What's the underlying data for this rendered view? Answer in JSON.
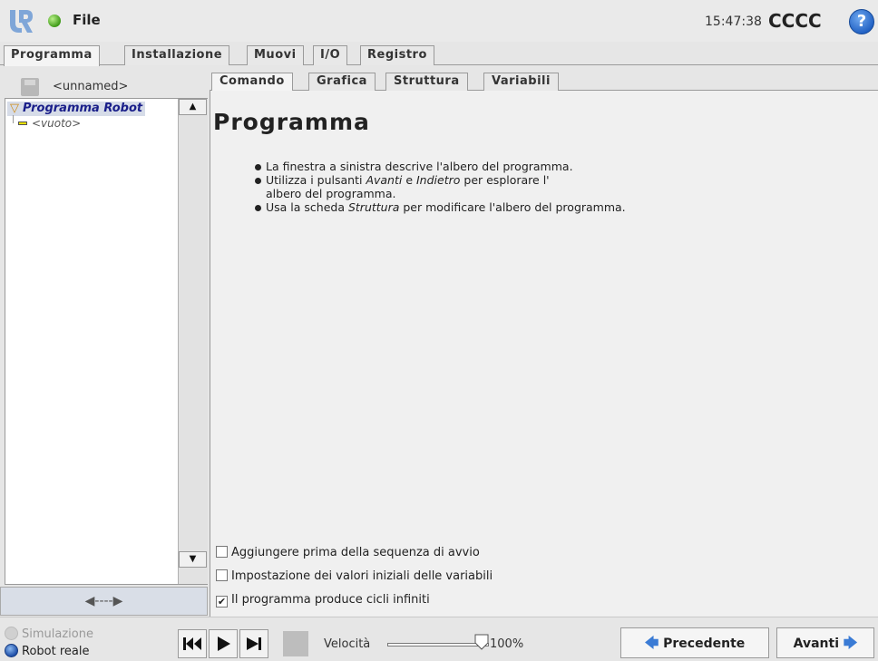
{
  "header": {
    "file_menu": "File",
    "clock": "15:47:38",
    "robot_name": "CCCC",
    "help_symbol": "?"
  },
  "main_tabs": [
    {
      "label": "Programma",
      "active": true
    },
    {
      "label": "Installazione",
      "active": false
    },
    {
      "label": "Muovi",
      "active": false
    },
    {
      "label": "I/O",
      "active": false
    },
    {
      "label": "Registro",
      "active": false
    }
  ],
  "left_panel": {
    "program_name": "<unnamed>",
    "tree_root": "Programma Robot",
    "tree_child": "<vuoto>",
    "arrow_control": "◀----▶"
  },
  "sub_tabs": [
    {
      "label": "Comando",
      "active": true
    },
    {
      "label": "Grafica",
      "active": false
    },
    {
      "label": "Struttura",
      "active": false
    },
    {
      "label": "Variabili",
      "active": false
    }
  ],
  "content": {
    "title": "Programma",
    "bullets": {
      "b1": "La finestra a sinistra descrive l'albero del programma.",
      "b2_pre": "Utilizza i pulsanti ",
      "b2_avanti": "Avanti",
      "b2_mid": " e ",
      "b2_indietro": "Indietro",
      "b2_post": " per esplorare l'",
      "b2_line2": "albero del programma.",
      "b3_pre": "Usa la scheda ",
      "b3_struttura": "Struttura",
      "b3_post": " per modificare l'albero del programma."
    },
    "options": [
      {
        "label": "Aggiungere prima della sequenza di avvio",
        "checked": false
      },
      {
        "label": "Impostazione dei valori iniziali delle variabili",
        "checked": false
      },
      {
        "label": "Il programma produce cicli infiniti",
        "checked": true
      }
    ]
  },
  "footer": {
    "mode_simulation": "Simulazione",
    "mode_real": "Robot reale",
    "speed_label": "Velocità",
    "speed_value": "100%",
    "speed_fraction": 1.0,
    "prev_label": "Precedente",
    "next_label": "Avanti"
  },
  "colors": {
    "accent_blue": "#3a7bd5",
    "status_green": "#3f9a18",
    "tree_highlight": "#d6dce8"
  }
}
